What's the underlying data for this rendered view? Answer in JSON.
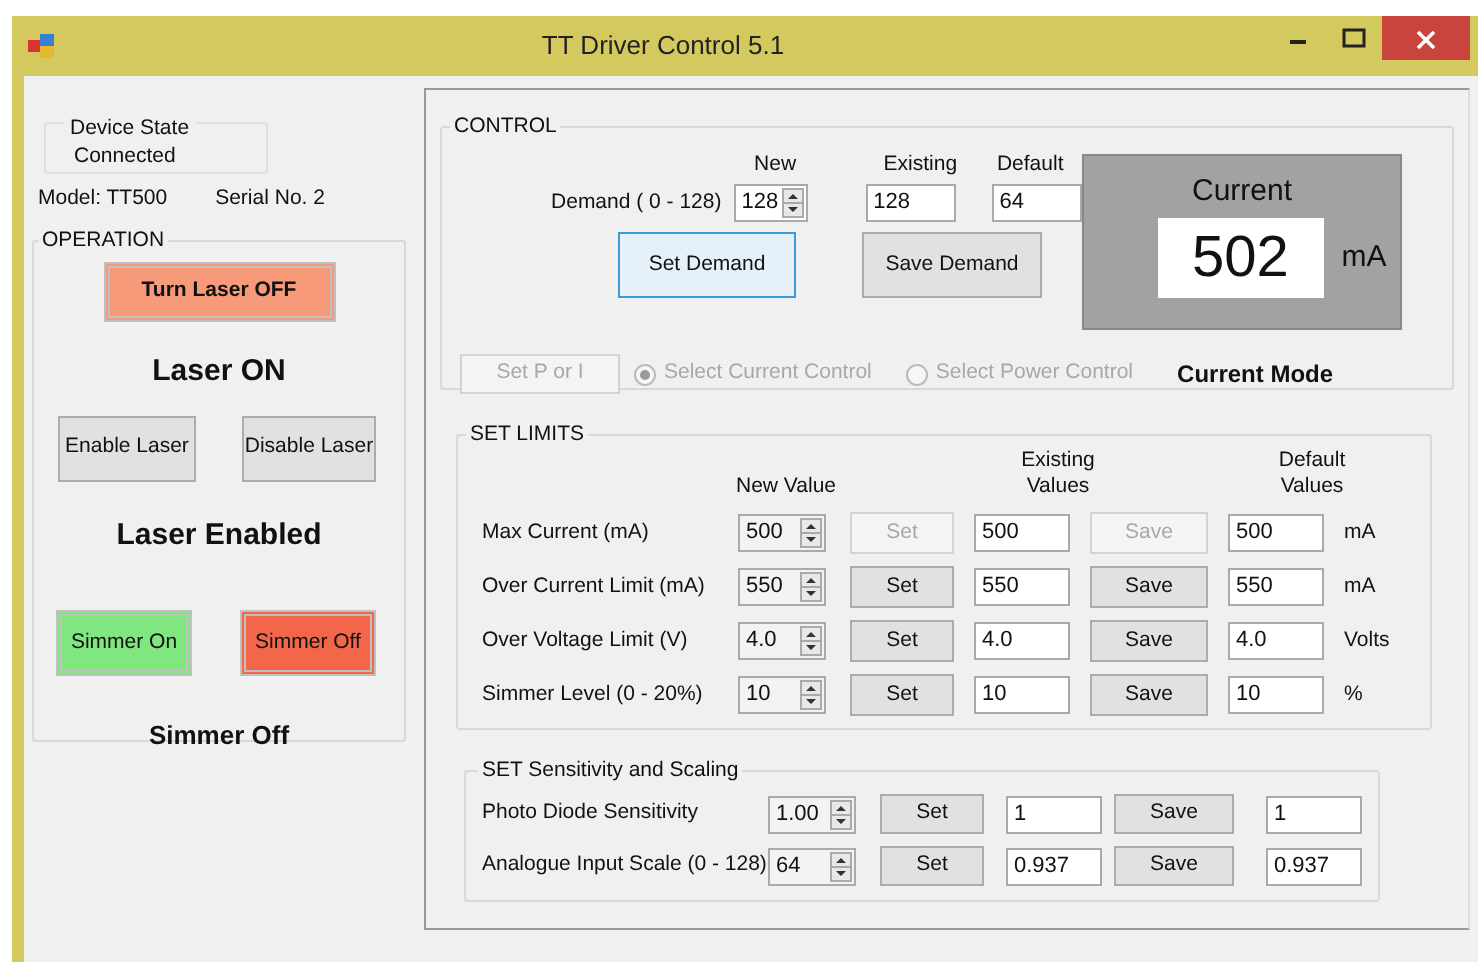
{
  "window": {
    "title": "TT Driver Control 5.1"
  },
  "device_state": {
    "legend": "Device State",
    "value": "Connected"
  },
  "model": "Model: TT500",
  "serial": "Serial No. 2",
  "operation": {
    "legend": "OPERATION",
    "laser_button": "Turn Laser OFF",
    "laser_status": "Laser  ON",
    "enable_buttons": [
      "Enable Laser",
      "Disable Laser"
    ],
    "enabled_status": "Laser Enabled",
    "simmer_buttons": [
      {
        "label": "Simmer On",
        "color": "#80e680"
      },
      {
        "label": "Simmer Off",
        "color": "#f4664a"
      }
    ],
    "simmer_status": "Simmer  Off"
  },
  "control": {
    "legend": "CONTROL",
    "demand_label": "Demand  ( 0 - 128)",
    "headers": [
      "New",
      "Existing",
      "Default"
    ],
    "new_value": "128",
    "existing_value": "128",
    "default_value": "64",
    "buttons": [
      {
        "label": "Set Demand",
        "focused": true
      },
      {
        "label": "Save Demand",
        "focused": false
      }
    ],
    "current": {
      "title": "Current",
      "value": "502",
      "unit": "mA"
    },
    "set_p_or_i": {
      "label": "Set  P or I",
      "disabled": true
    },
    "modes": [
      {
        "label": "Select Current Control",
        "selected": true,
        "disabled": true
      },
      {
        "label": "Select Power Control",
        "selected": false,
        "disabled": true
      }
    ],
    "mode_status": "Current Mode"
  },
  "limits": {
    "legend": "SET LIMITS",
    "headers": [
      "New Value",
      "Existing Values",
      "Default Values"
    ],
    "rows": [
      {
        "label": "Max Current (mA)",
        "new": "500",
        "set": "Set",
        "set_disabled": true,
        "existing": "500",
        "save": "Save",
        "save_disabled": true,
        "default": "500",
        "unit": "mA"
      },
      {
        "label": "Over Current Limit (mA)",
        "new": "550",
        "set": "Set",
        "set_disabled": false,
        "existing": "550",
        "save": "Save",
        "save_disabled": false,
        "default": "550",
        "unit": "mA"
      },
      {
        "label": "Over Voltage Limit (V)",
        "new": "4.0",
        "set": "Set",
        "set_disabled": false,
        "existing": "4.0",
        "save": "Save",
        "save_disabled": false,
        "default": "4.0",
        "unit": "Volts"
      },
      {
        "label": "Simmer Level (0 - 20%)",
        "new": "10",
        "set": "Set",
        "set_disabled": false,
        "existing": "10",
        "save": "Save",
        "save_disabled": false,
        "default": "10",
        "unit": "%"
      }
    ]
  },
  "sensitivity": {
    "legend": "SET Sensitivity  and  Scaling",
    "rows": [
      {
        "label": "Photo Diode Sensitivity",
        "new": "1.00",
        "set": "Set",
        "existing": "1",
        "save": "Save",
        "default": "1"
      },
      {
        "label": "Analogue Input Scale (0 - 128)",
        "new": "64",
        "set": "Set",
        "existing": "0.937",
        "save": "Save",
        "default": "0.937"
      }
    ]
  }
}
